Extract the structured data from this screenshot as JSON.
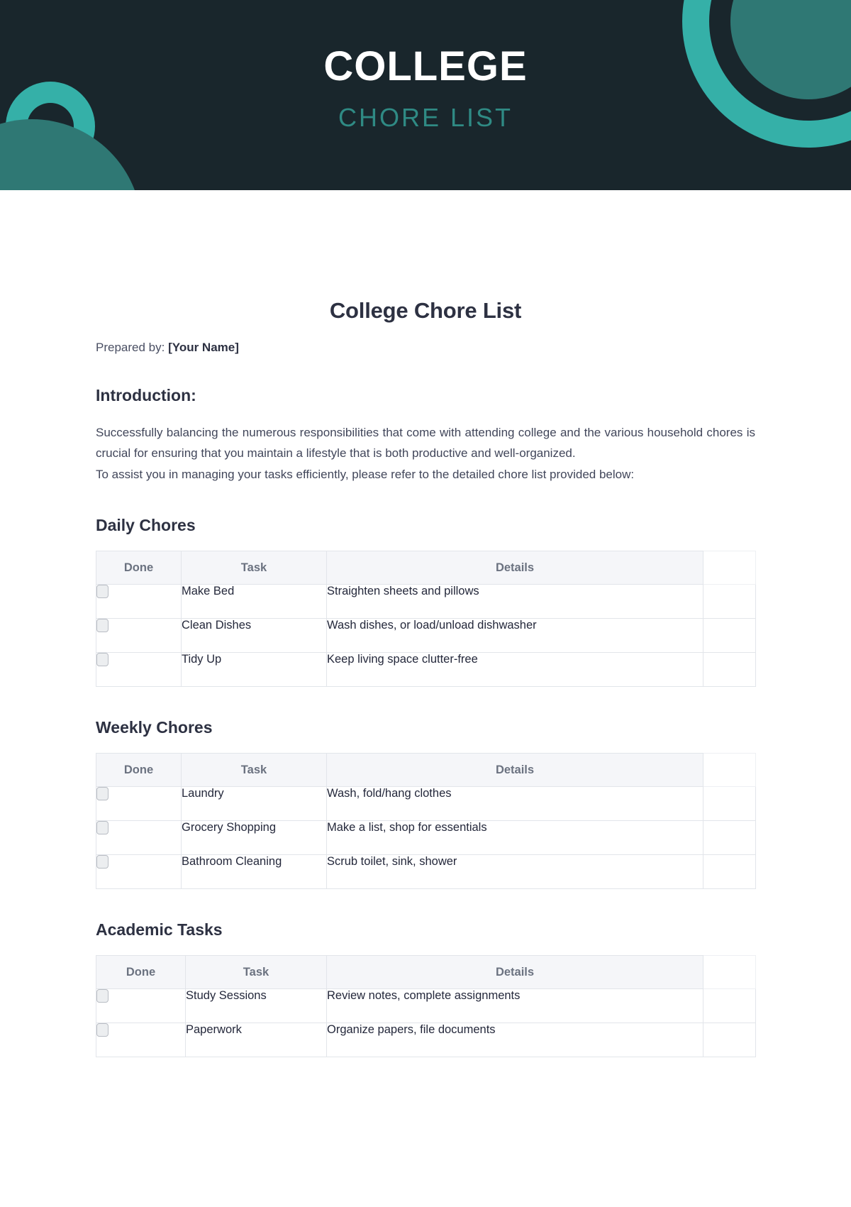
{
  "banner": {
    "title": "COLLEGE",
    "subtitle": "CHORE LIST",
    "bg_color": "#19262c",
    "accent_color": "#35b0a8",
    "accent_dark_color": "#2f7874",
    "subtitle_color": "#2f8a84"
  },
  "document": {
    "title": "College Chore List",
    "prepared_by_label": "Prepared by:",
    "prepared_by_value": "[Your Name]",
    "introduction_heading": "Introduction:",
    "intro_paragraph_1": "Successfully balancing the numerous responsibilities that come with attending college and the various household chores is crucial for ensuring that you maintain a lifestyle that is both productive and well-organized.",
    "intro_paragraph_2": "To assist you in managing your tasks efficiently, please refer to the detailed chore list provided below:"
  },
  "tables": [
    {
      "heading": "Daily Chores",
      "columns": [
        "Done",
        "Task",
        "Details"
      ],
      "rows": [
        {
          "task": "Make Bed",
          "details": "Straighten sheets and pillows",
          "done": false
        },
        {
          "task": "Clean Dishes",
          "details": "Wash dishes, or load/unload dishwasher",
          "done": false
        },
        {
          "task": "Tidy Up",
          "details": "Keep living space clutter-free",
          "done": false
        }
      ]
    },
    {
      "heading": "Weekly Chores",
      "columns": [
        "Done",
        "Task",
        "Details"
      ],
      "rows": [
        {
          "task": "Laundry",
          "details": "Wash, fold/hang clothes",
          "done": false
        },
        {
          "task": "Grocery Shopping",
          "details": "Make a list, shop for essentials",
          "done": false
        },
        {
          "task": "Bathroom Cleaning",
          "details": "Scrub toilet, sink, shower",
          "done": false
        }
      ]
    },
    {
      "heading": "Academic Tasks",
      "columns": [
        "Done",
        "Task",
        "Details"
      ],
      "rows": [
        {
          "task": "Study Sessions",
          "details": "Review notes, complete assignments",
          "done": false
        },
        {
          "task": "Paperwork",
          "details": "Organize papers, file documents",
          "done": false
        }
      ]
    }
  ]
}
